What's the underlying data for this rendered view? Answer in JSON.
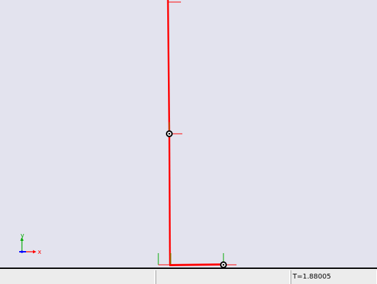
{
  "colors": {
    "background": "#e3e3ee",
    "link": "#ff0000",
    "axis_x": "#ff0000",
    "axis_y": "#00aa00",
    "axis_z": "#0000ff",
    "statusbar": "#ececec"
  },
  "axes": {
    "x_label": "x",
    "y_label": "y"
  },
  "statusbar": {
    "cell_1": "",
    "cell_2": "",
    "time_readout": "T=1.88005"
  }
}
